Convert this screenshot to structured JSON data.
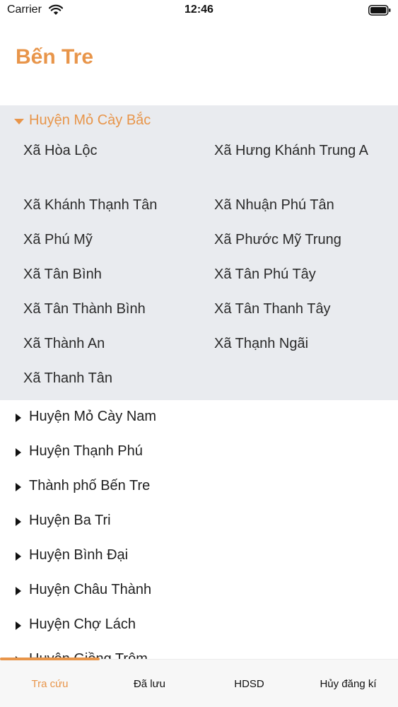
{
  "status_bar": {
    "carrier": "Carrier",
    "time": "12:46"
  },
  "header": {
    "title": "Bến Tre"
  },
  "districts": [
    {
      "label": "Huyện Mỏ Cày Bắc",
      "expanded": true,
      "communes": [
        "Xã Hòa Lộc",
        "Xã Hưng Khánh Trung A",
        "Xã Khánh Thạnh Tân",
        "Xã Nhuận Phú Tân",
        "Xã Phú Mỹ",
        "Xã Phước Mỹ Trung",
        "Xã Tân Bình",
        "Xã Tân Phú Tây",
        "Xã Tân Thành Bình",
        "Xã Tân Thanh Tây",
        "Xã Thành An",
        "Xã Thạnh Ngãi",
        "Xã Thanh Tân"
      ]
    },
    {
      "label": "Huyện Mỏ Cày Nam",
      "expanded": false
    },
    {
      "label": "Huyện Thạnh Phú",
      "expanded": false
    },
    {
      "label": "Thành phố Bến Tre",
      "expanded": false
    },
    {
      "label": "Huyện Ba Tri",
      "expanded": false
    },
    {
      "label": "Huyện Bình Đại",
      "expanded": false
    },
    {
      "label": "Huyện Châu Thành",
      "expanded": false
    },
    {
      "label": "Huyện Chợ Lách",
      "expanded": false
    },
    {
      "label": "Huyện Giồng Trôm",
      "expanded": false
    }
  ],
  "tabs": [
    {
      "label": "Tra cứu",
      "active": true
    },
    {
      "label": "Đã lưu",
      "active": false
    },
    {
      "label": "HDSD",
      "active": false
    },
    {
      "label": "Hủy đăng kí",
      "active": false
    }
  ],
  "colors": {
    "accent": "#e8954a",
    "expanded_background": "#e9ebef",
    "tab_bar_background": "#f7f7f7"
  },
  "icons": {
    "wifi": "wifi-icon",
    "battery": "battery-icon",
    "expanded": "caret-down-icon",
    "collapsed": "caret-right-icon"
  }
}
